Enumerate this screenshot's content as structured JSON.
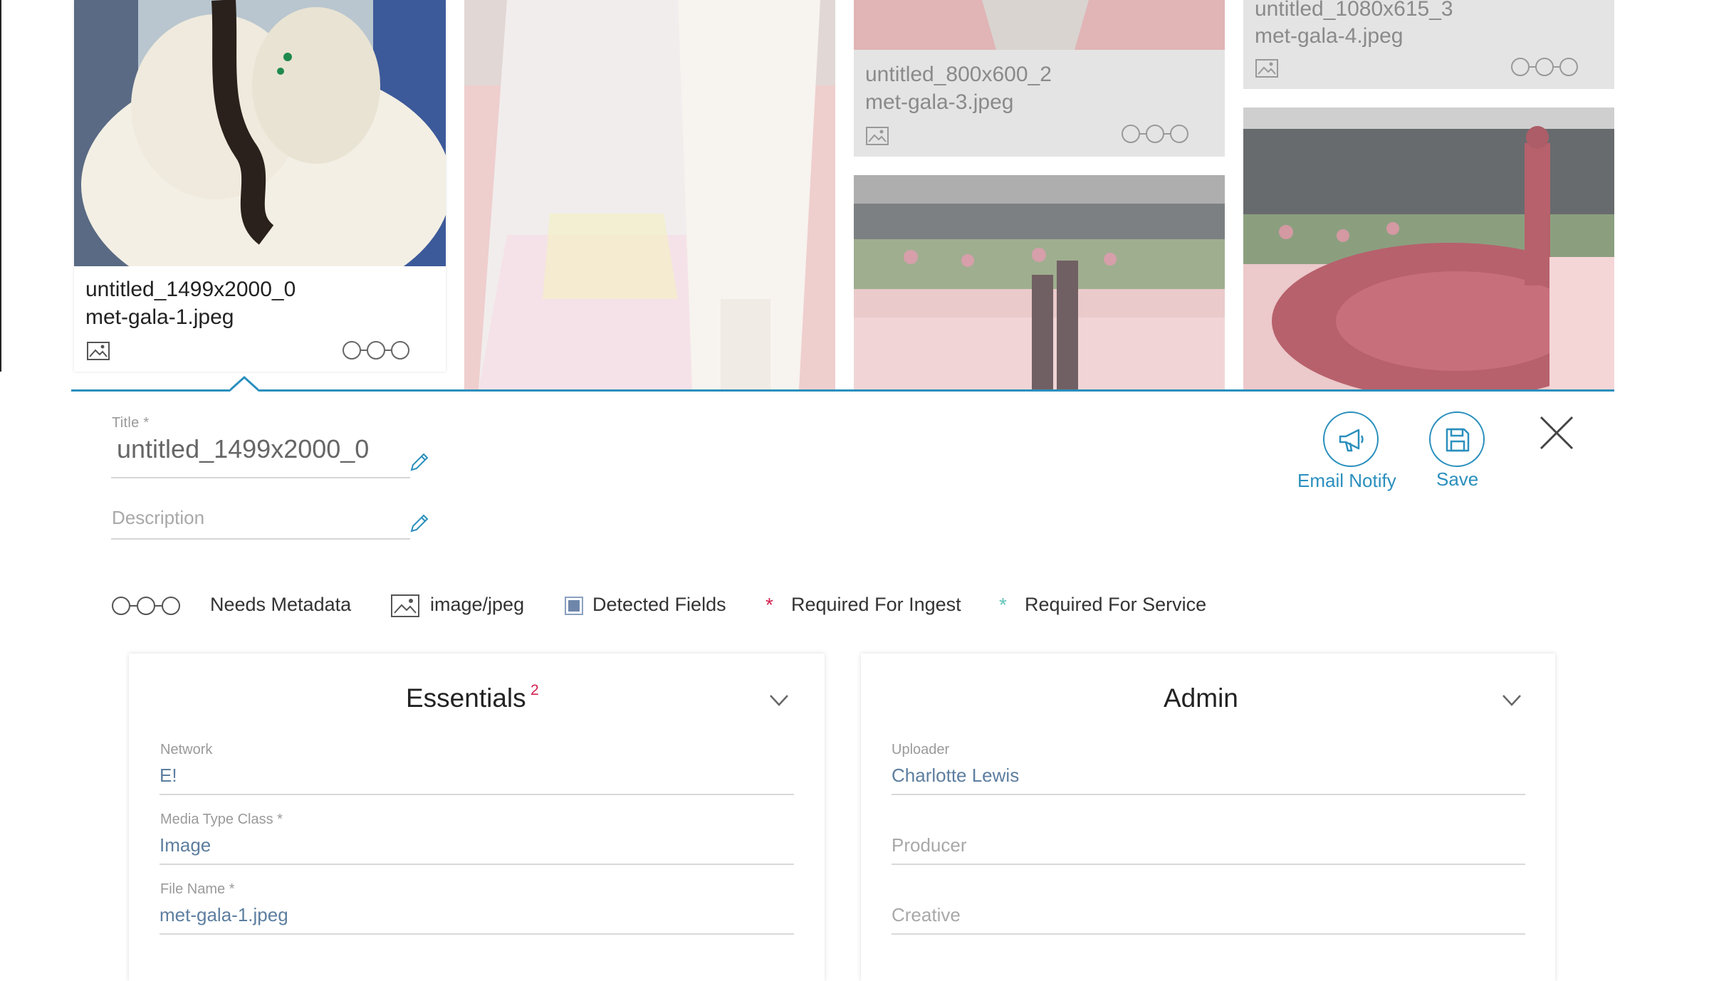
{
  "gallery": {
    "cards": [
      {
        "title": "untitled_1499x2000_0",
        "file": "met-gala-1.jpeg"
      },
      {
        "title": "untitled_800x600_2",
        "file": "met-gala-3.jpeg"
      },
      {
        "title": "untitled_1080x615_3",
        "file": "met-gala-4.jpeg"
      }
    ]
  },
  "detail": {
    "title_label": "Title *",
    "title_value": "untitled_1499x2000_0",
    "description_placeholder": "Description",
    "actions": {
      "email_notify": "Email Notify",
      "save": "Save"
    },
    "legend": {
      "needs_metadata": "Needs Metadata",
      "media_type": "image/jpeg",
      "detected_fields": "Detected Fields",
      "required_ingest": "Required For Ingest",
      "required_service": "Required For Service"
    }
  },
  "essentials": {
    "title": "Essentials",
    "count": "2",
    "fields": [
      {
        "label": "Network",
        "value": "E!"
      },
      {
        "label": "Media Type Class  *",
        "value": "Image"
      },
      {
        "label": "File Name  *",
        "value": "met-gala-1.jpeg"
      }
    ]
  },
  "admin": {
    "title": "Admin",
    "uploader_label": "Uploader",
    "uploader_value": "Charlotte Lewis",
    "producer_placeholder": "Producer",
    "creative_placeholder": "Creative"
  },
  "colors": {
    "accent": "#2a8fbd",
    "required_ingest": "#d32050",
    "required_service": "#5fc3b8",
    "value_text": "#5d7e9f"
  },
  "icons": [
    "image-icon",
    "status-steps-icon",
    "pencil-icon",
    "megaphone-icon",
    "floppy-disk-icon",
    "close-icon",
    "chevron-down-icon",
    "asterisk-icon",
    "square-icon"
  ]
}
